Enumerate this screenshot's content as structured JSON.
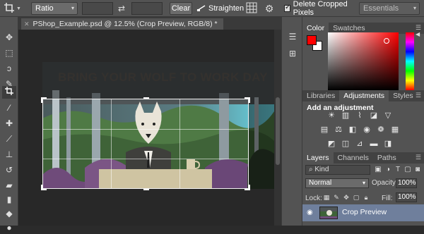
{
  "options_bar": {
    "ratio": "Ratio",
    "width_value": "",
    "height_value": "",
    "clear": "Clear",
    "straighten": "Straighten",
    "delete_cropped_label": "Delete Cropped Pixels",
    "delete_cropped_checked": true,
    "workspace": "Essentials"
  },
  "document": {
    "tab_title": "PShop_Example.psd @ 12.5% (Crop Preview, RGB/8) *",
    "artwork_headline": "BRING YOUR WOLF TO WORK DAY"
  },
  "color_panel": {
    "tabs": [
      "Color",
      "Swatches"
    ],
    "foreground": "#ff0000",
    "background": "#ffffff"
  },
  "adjustments_panel": {
    "tabs": [
      "Libraries",
      "Adjustments",
      "Styles"
    ],
    "title": "Add an adjustment",
    "row1_icons": [
      "brightness-contrast-icon",
      "levels-icon",
      "curves-icon",
      "exposure-icon",
      "vibrance-icon"
    ],
    "row2_icons": [
      "hue-saturation-icon",
      "color-balance-icon",
      "black-white-icon",
      "photo-filter-icon",
      "channel-mixer-icon",
      "color-lookup-icon"
    ],
    "row3_icons": [
      "invert-icon",
      "posterize-icon",
      "threshold-icon",
      "gradient-map-icon",
      "selective-color-icon"
    ]
  },
  "layers_panel": {
    "tabs": [
      "Layers",
      "Channels",
      "Paths"
    ],
    "kind_filter": "Kind",
    "blend_mode": "Normal",
    "opacity_label": "Opacity:",
    "opacity_value": "100%",
    "lock_label": "Lock:",
    "fill_label": "Fill:",
    "fill_value": "100%",
    "layers": [
      {
        "name": "Crop Preview",
        "visible": true,
        "selected": true
      }
    ]
  }
}
